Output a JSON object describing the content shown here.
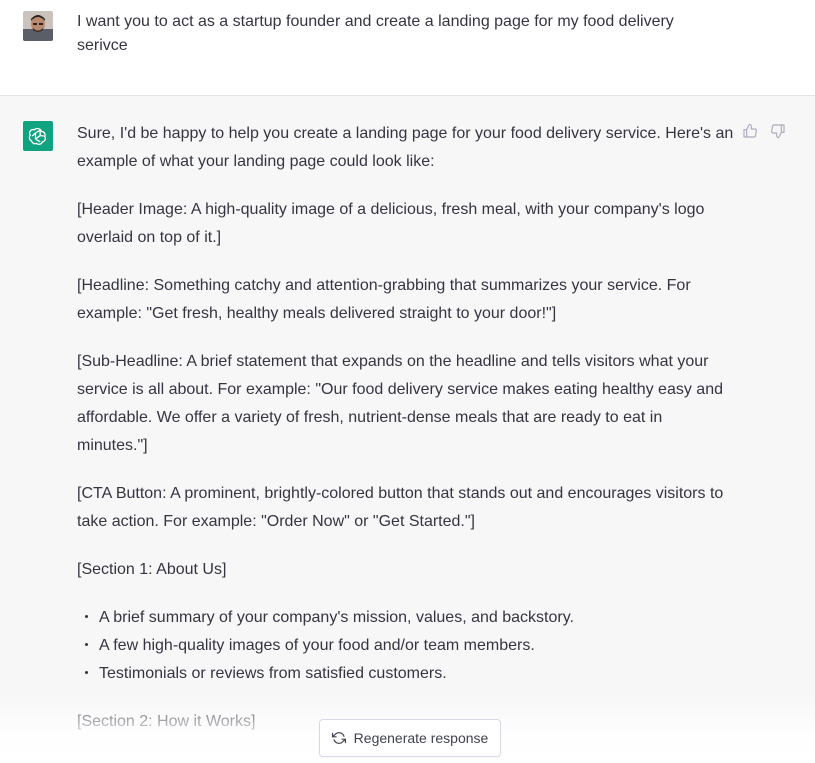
{
  "user_message": {
    "text": "I want you to act as a startup founder and create a landing page for my food delivery serivce"
  },
  "assistant_message": {
    "paragraphs": [
      "Sure, I'd be happy to help you create a landing page for your food delivery service. Here's an example of what your landing page could look like:",
      "[Header Image: A high-quality image of a delicious, fresh meal, with your company's logo overlaid on top of it.]",
      "[Headline: Something catchy and attention-grabbing that summarizes your service. For example: \"Get fresh, healthy meals delivered straight to your door!\"]",
      "[Sub-Headline: A brief statement that expands on the headline and tells visitors what your service is all about. For example: \"Our food delivery service makes eating healthy easy and affordable. We offer a variety of fresh, nutrient-dense meals that are ready to eat in minutes.\"]",
      "[CTA Button: A prominent, brightly-colored button that stands out and encourages visitors to take action. For example: \"Order Now\" or \"Get Started.\"]",
      "[Section 1: About Us]"
    ],
    "bullets": [
      "A brief summary of your company's mission, values, and backstory.",
      "A few high-quality images of your food and/or team members.",
      "Testimonials or reviews from satisfied customers."
    ],
    "trailing_paragraph": "[Section 2: How it Works]"
  },
  "feedback": {
    "thumbs_up_icon": "thumbs-up-icon",
    "thumbs_down_icon": "thumbs-down-icon"
  },
  "regenerate_button": {
    "label": "Regenerate response",
    "icon": "refresh-icon"
  },
  "colors": {
    "assistant_bg": "#f7f7f8",
    "bot_avatar": "#10a37f",
    "text": "#343541"
  }
}
